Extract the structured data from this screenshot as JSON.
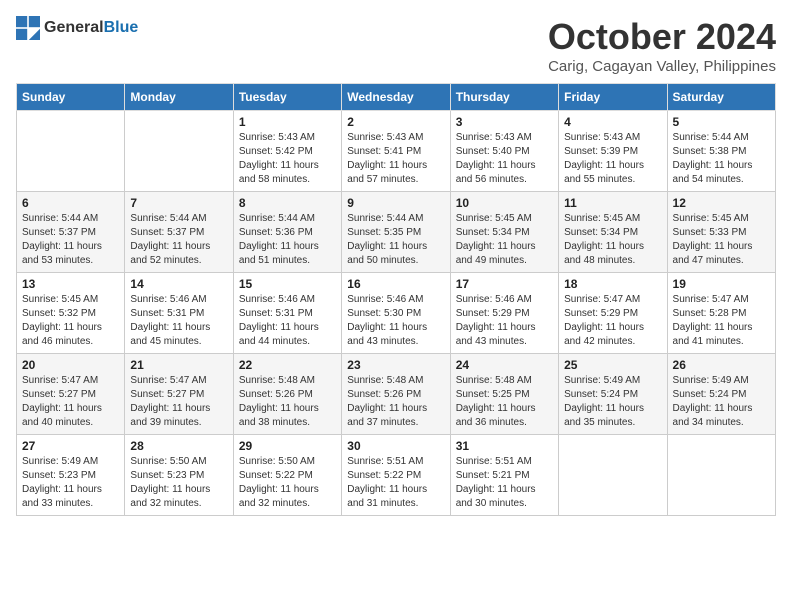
{
  "logo": {
    "general": "General",
    "blue": "Blue"
  },
  "title": "October 2024",
  "location": "Carig, Cagayan Valley, Philippines",
  "weekdays": [
    "Sunday",
    "Monday",
    "Tuesday",
    "Wednesday",
    "Thursday",
    "Friday",
    "Saturday"
  ],
  "weeks": [
    [
      {
        "day": "",
        "sunrise": "",
        "sunset": "",
        "daylight": ""
      },
      {
        "day": "",
        "sunrise": "",
        "sunset": "",
        "daylight": ""
      },
      {
        "day": "1",
        "sunrise": "Sunrise: 5:43 AM",
        "sunset": "Sunset: 5:42 PM",
        "daylight": "Daylight: 11 hours and 58 minutes."
      },
      {
        "day": "2",
        "sunrise": "Sunrise: 5:43 AM",
        "sunset": "Sunset: 5:41 PM",
        "daylight": "Daylight: 11 hours and 57 minutes."
      },
      {
        "day": "3",
        "sunrise": "Sunrise: 5:43 AM",
        "sunset": "Sunset: 5:40 PM",
        "daylight": "Daylight: 11 hours and 56 minutes."
      },
      {
        "day": "4",
        "sunrise": "Sunrise: 5:43 AM",
        "sunset": "Sunset: 5:39 PM",
        "daylight": "Daylight: 11 hours and 55 minutes."
      },
      {
        "day": "5",
        "sunrise": "Sunrise: 5:44 AM",
        "sunset": "Sunset: 5:38 PM",
        "daylight": "Daylight: 11 hours and 54 minutes."
      }
    ],
    [
      {
        "day": "6",
        "sunrise": "Sunrise: 5:44 AM",
        "sunset": "Sunset: 5:37 PM",
        "daylight": "Daylight: 11 hours and 53 minutes."
      },
      {
        "day": "7",
        "sunrise": "Sunrise: 5:44 AM",
        "sunset": "Sunset: 5:37 PM",
        "daylight": "Daylight: 11 hours and 52 minutes."
      },
      {
        "day": "8",
        "sunrise": "Sunrise: 5:44 AM",
        "sunset": "Sunset: 5:36 PM",
        "daylight": "Daylight: 11 hours and 51 minutes."
      },
      {
        "day": "9",
        "sunrise": "Sunrise: 5:44 AM",
        "sunset": "Sunset: 5:35 PM",
        "daylight": "Daylight: 11 hours and 50 minutes."
      },
      {
        "day": "10",
        "sunrise": "Sunrise: 5:45 AM",
        "sunset": "Sunset: 5:34 PM",
        "daylight": "Daylight: 11 hours and 49 minutes."
      },
      {
        "day": "11",
        "sunrise": "Sunrise: 5:45 AM",
        "sunset": "Sunset: 5:34 PM",
        "daylight": "Daylight: 11 hours and 48 minutes."
      },
      {
        "day": "12",
        "sunrise": "Sunrise: 5:45 AM",
        "sunset": "Sunset: 5:33 PM",
        "daylight": "Daylight: 11 hours and 47 minutes."
      }
    ],
    [
      {
        "day": "13",
        "sunrise": "Sunrise: 5:45 AM",
        "sunset": "Sunset: 5:32 PM",
        "daylight": "Daylight: 11 hours and 46 minutes."
      },
      {
        "day": "14",
        "sunrise": "Sunrise: 5:46 AM",
        "sunset": "Sunset: 5:31 PM",
        "daylight": "Daylight: 11 hours and 45 minutes."
      },
      {
        "day": "15",
        "sunrise": "Sunrise: 5:46 AM",
        "sunset": "Sunset: 5:31 PM",
        "daylight": "Daylight: 11 hours and 44 minutes."
      },
      {
        "day": "16",
        "sunrise": "Sunrise: 5:46 AM",
        "sunset": "Sunset: 5:30 PM",
        "daylight": "Daylight: 11 hours and 43 minutes."
      },
      {
        "day": "17",
        "sunrise": "Sunrise: 5:46 AM",
        "sunset": "Sunset: 5:29 PM",
        "daylight": "Daylight: 11 hours and 43 minutes."
      },
      {
        "day": "18",
        "sunrise": "Sunrise: 5:47 AM",
        "sunset": "Sunset: 5:29 PM",
        "daylight": "Daylight: 11 hours and 42 minutes."
      },
      {
        "day": "19",
        "sunrise": "Sunrise: 5:47 AM",
        "sunset": "Sunset: 5:28 PM",
        "daylight": "Daylight: 11 hours and 41 minutes."
      }
    ],
    [
      {
        "day": "20",
        "sunrise": "Sunrise: 5:47 AM",
        "sunset": "Sunset: 5:27 PM",
        "daylight": "Daylight: 11 hours and 40 minutes."
      },
      {
        "day": "21",
        "sunrise": "Sunrise: 5:47 AM",
        "sunset": "Sunset: 5:27 PM",
        "daylight": "Daylight: 11 hours and 39 minutes."
      },
      {
        "day": "22",
        "sunrise": "Sunrise: 5:48 AM",
        "sunset": "Sunset: 5:26 PM",
        "daylight": "Daylight: 11 hours and 38 minutes."
      },
      {
        "day": "23",
        "sunrise": "Sunrise: 5:48 AM",
        "sunset": "Sunset: 5:26 PM",
        "daylight": "Daylight: 11 hours and 37 minutes."
      },
      {
        "day": "24",
        "sunrise": "Sunrise: 5:48 AM",
        "sunset": "Sunset: 5:25 PM",
        "daylight": "Daylight: 11 hours and 36 minutes."
      },
      {
        "day": "25",
        "sunrise": "Sunrise: 5:49 AM",
        "sunset": "Sunset: 5:24 PM",
        "daylight": "Daylight: 11 hours and 35 minutes."
      },
      {
        "day": "26",
        "sunrise": "Sunrise: 5:49 AM",
        "sunset": "Sunset: 5:24 PM",
        "daylight": "Daylight: 11 hours and 34 minutes."
      }
    ],
    [
      {
        "day": "27",
        "sunrise": "Sunrise: 5:49 AM",
        "sunset": "Sunset: 5:23 PM",
        "daylight": "Daylight: 11 hours and 33 minutes."
      },
      {
        "day": "28",
        "sunrise": "Sunrise: 5:50 AM",
        "sunset": "Sunset: 5:23 PM",
        "daylight": "Daylight: 11 hours and 32 minutes."
      },
      {
        "day": "29",
        "sunrise": "Sunrise: 5:50 AM",
        "sunset": "Sunset: 5:22 PM",
        "daylight": "Daylight: 11 hours and 32 minutes."
      },
      {
        "day": "30",
        "sunrise": "Sunrise: 5:51 AM",
        "sunset": "Sunset: 5:22 PM",
        "daylight": "Daylight: 11 hours and 31 minutes."
      },
      {
        "day": "31",
        "sunrise": "Sunrise: 5:51 AM",
        "sunset": "Sunset: 5:21 PM",
        "daylight": "Daylight: 11 hours and 30 minutes."
      },
      {
        "day": "",
        "sunrise": "",
        "sunset": "",
        "daylight": ""
      },
      {
        "day": "",
        "sunrise": "",
        "sunset": "",
        "daylight": ""
      }
    ]
  ]
}
